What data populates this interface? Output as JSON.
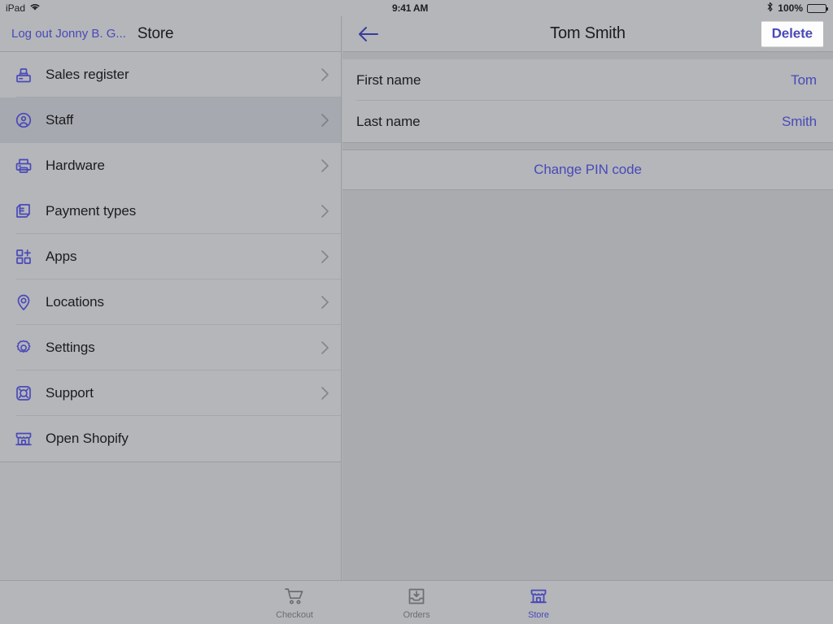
{
  "status_bar": {
    "device": "iPad",
    "wifi_icon": "wifi-icon",
    "time": "9:41 AM",
    "bluetooth_icon": "bluetooth-icon",
    "battery_percent": "100%",
    "battery_icon": "battery-full-icon"
  },
  "colors": {
    "accent": "#4a49b8",
    "background": "#b0b2b6",
    "panel": "#b4b6ba",
    "selected_row": "#a7a9b0",
    "separator": "#a4a7ab",
    "text": "#1c1c1e",
    "muted_text": "#6c6e72"
  },
  "left_panel": {
    "logout_label": "Log out Jonny B. G...",
    "title": "Store",
    "menu_items": [
      {
        "label": "Sales register",
        "icon": "cash-register-icon",
        "chevron": true,
        "selected": false
      },
      {
        "label": "Staff",
        "icon": "person-circle-icon",
        "chevron": true,
        "selected": true
      },
      {
        "label": "Hardware",
        "icon": "printer-icon",
        "chevron": true,
        "selected": false
      },
      {
        "label": "Payment types",
        "icon": "payment-cards-icon",
        "chevron": true,
        "selected": false
      },
      {
        "label": "Apps",
        "icon": "apps-grid-plus-icon",
        "chevron": true,
        "selected": false
      },
      {
        "label": "Locations",
        "icon": "map-pin-icon",
        "chevron": true,
        "selected": false
      },
      {
        "label": "Settings",
        "icon": "gear-icon",
        "chevron": true,
        "selected": false
      },
      {
        "label": "Support",
        "icon": "life-ring-icon",
        "chevron": true,
        "selected": false
      },
      {
        "label": "Open Shopify",
        "icon": "storefront-icon",
        "chevron": false,
        "selected": false
      }
    ]
  },
  "right_panel": {
    "back_icon": "back-arrow-icon",
    "title": "Tom Smith",
    "delete_label": "Delete",
    "fields": [
      {
        "label": "First name",
        "value": "Tom"
      },
      {
        "label": "Last name",
        "value": "Smith"
      }
    ],
    "change_pin_label": "Change PIN code"
  },
  "tab_bar": {
    "tabs": [
      {
        "label": "Checkout",
        "icon": "shopping-cart-icon",
        "active": false
      },
      {
        "label": "Orders",
        "icon": "inbox-download-icon",
        "active": false
      },
      {
        "label": "Store",
        "icon": "storefront-icon",
        "active": true
      }
    ]
  }
}
